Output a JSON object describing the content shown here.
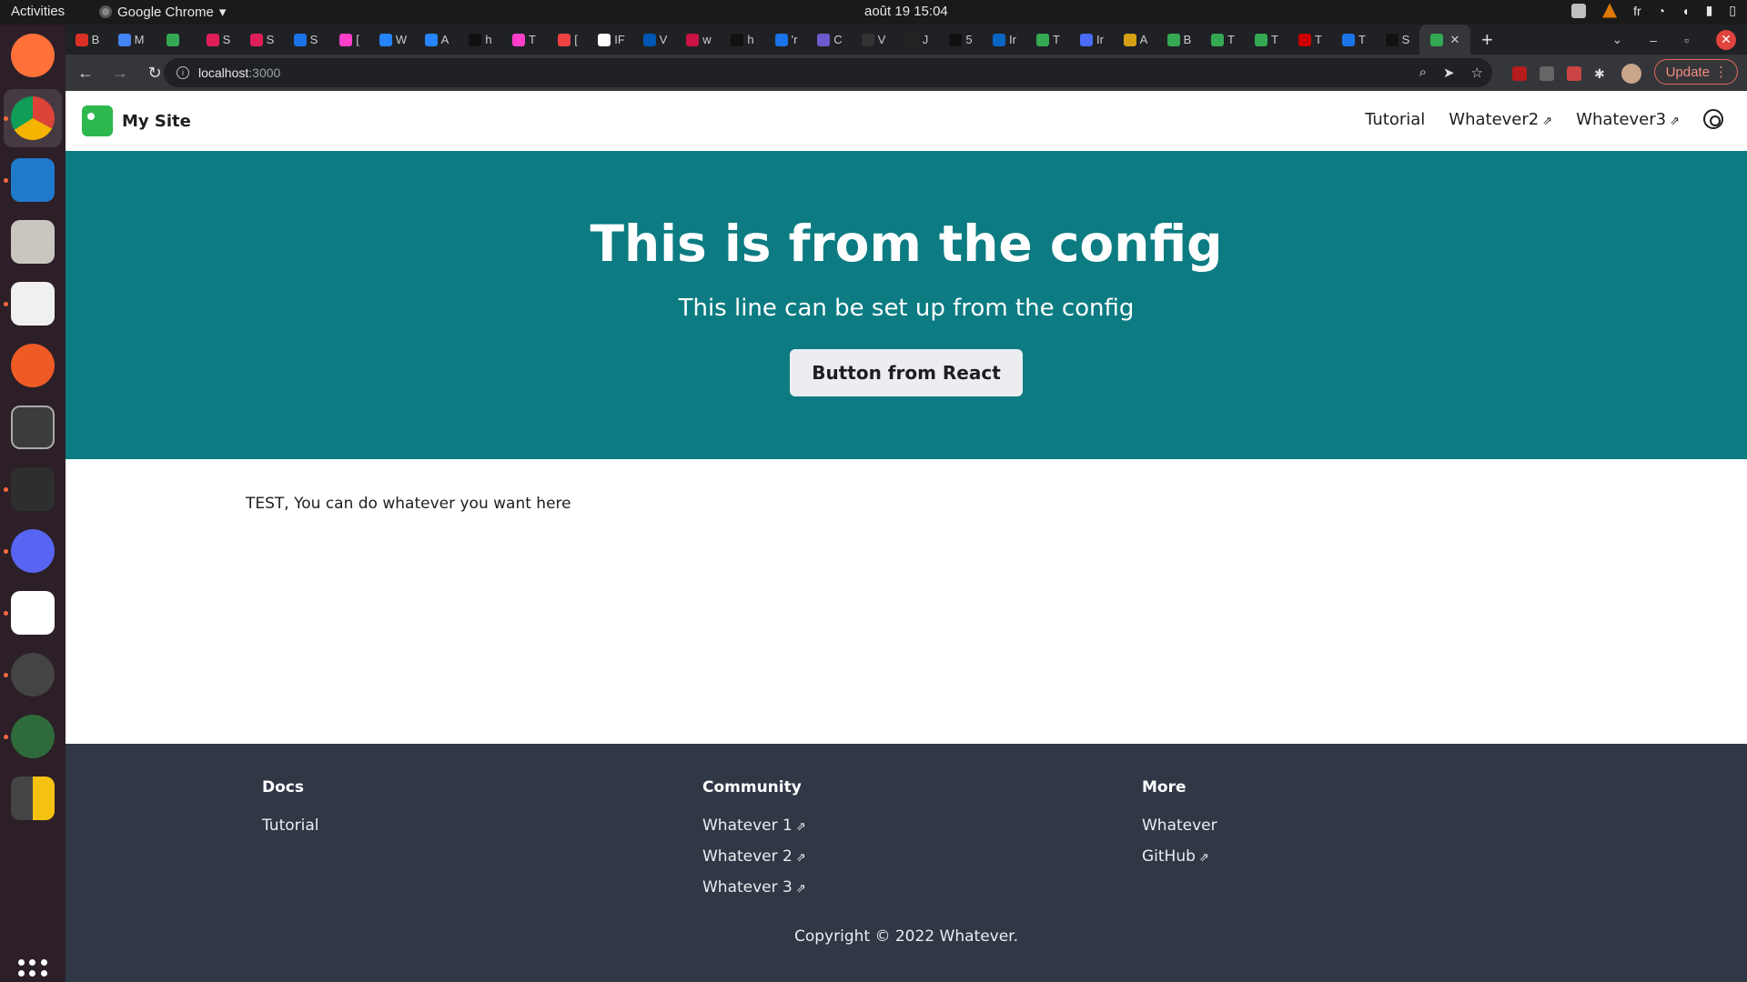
{
  "system": {
    "activities": "Activities",
    "app_name": "Google Chrome",
    "clock": "août 19  15:04",
    "lang": "fr"
  },
  "browser": {
    "url_host": "localhost",
    "url_port": ":3000",
    "update_label": "Update",
    "tabs": [
      "B",
      "M",
      "",
      "S",
      "S",
      "S",
      "[",
      "W",
      "A",
      "h",
      "T",
      "[",
      "IF",
      "V",
      "w",
      "h",
      "'r",
      "C",
      "V",
      "J",
      "5",
      "Ir",
      "T",
      "Ir",
      "A",
      "B",
      "T",
      "T",
      "T",
      "T",
      "S",
      ""
    ]
  },
  "site": {
    "brand": "My Site",
    "nav": {
      "tutorial": "Tutorial",
      "whatever2": "Whatever2",
      "whatever3": "Whatever3"
    },
    "hero": {
      "title": "This is from the config",
      "subtitle": "This line can be set up from the config",
      "button": "Button from React"
    },
    "main_text": "TEST, You can do whatever you want here",
    "footer": {
      "docs": {
        "title": "Docs",
        "links": [
          "Tutorial"
        ]
      },
      "community": {
        "title": "Community",
        "links": [
          "Whatever 1",
          "Whatever 2",
          "Whatever 3"
        ]
      },
      "more": {
        "title": "More",
        "links": [
          "Whatever",
          "GitHub"
        ]
      },
      "copyright": "Copyright © 2022 Whatever."
    }
  }
}
